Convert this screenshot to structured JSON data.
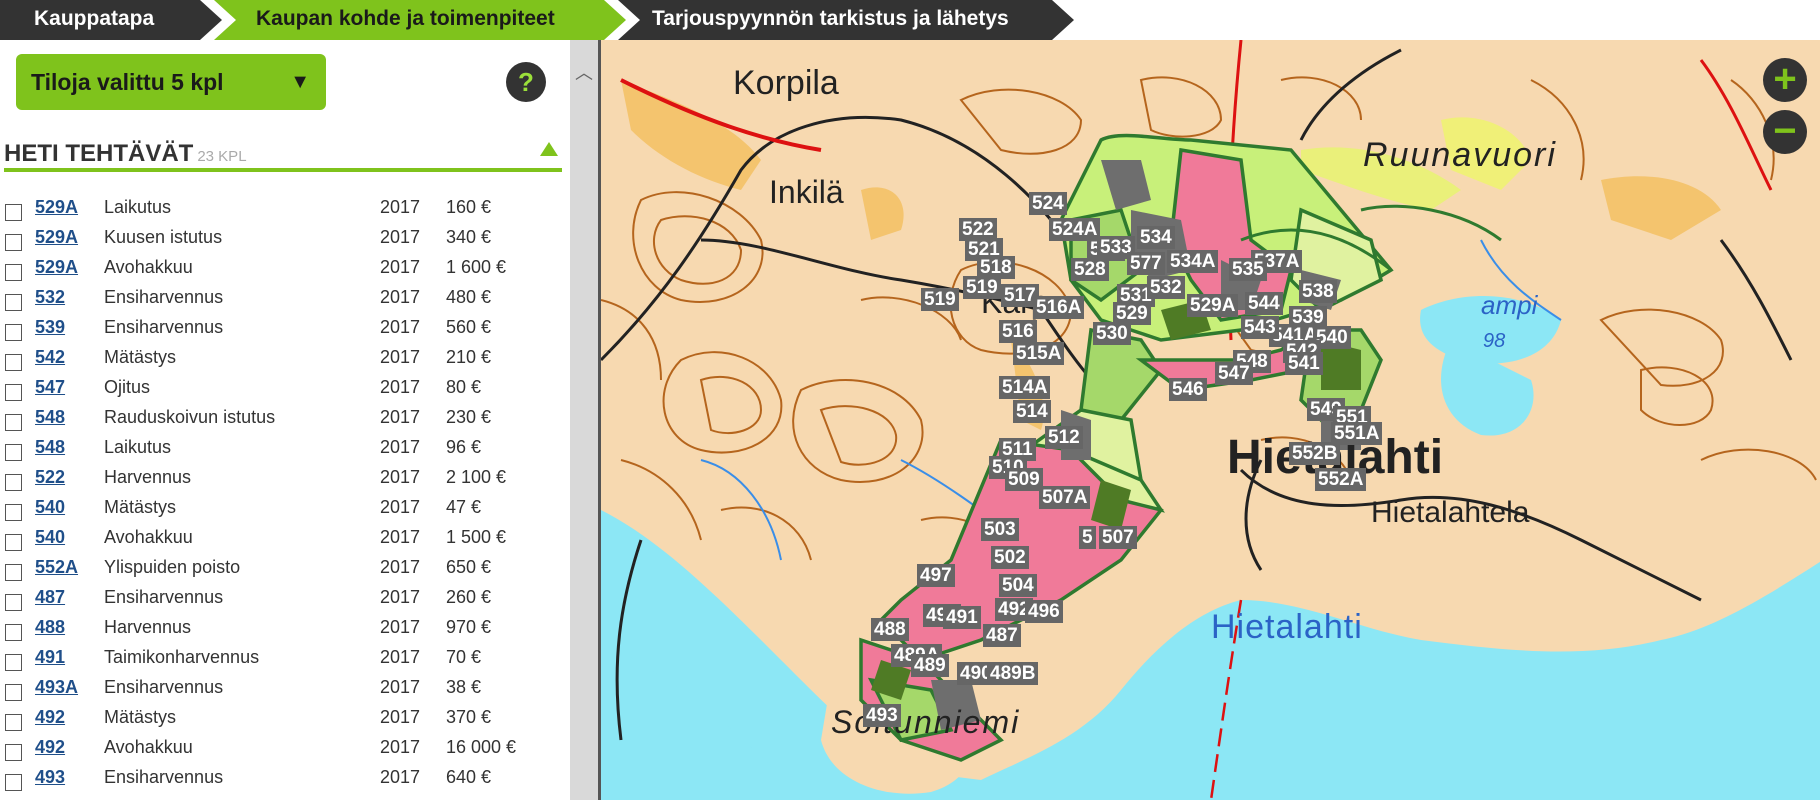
{
  "wizard": {
    "step1": "Kauppatapa",
    "step2": "Kaupan kohde ja toimenpiteet",
    "step3": "Tarjouspyynnön tarkistus ja lähetys"
  },
  "selector": {
    "label": "Tiloja valittu 5 kpl",
    "caret": "▼"
  },
  "help": "?",
  "section": {
    "title": "HETI TEHTÄVÄT",
    "count": "23 KPL"
  },
  "tasks": [
    {
      "code": "529A",
      "name": "Laikutus",
      "year": "2017",
      "price": "160 €"
    },
    {
      "code": "529A",
      "name": "Kuusen istutus",
      "year": "2017",
      "price": "340 €"
    },
    {
      "code": "529A",
      "name": "Avohakkuu",
      "year": "2017",
      "price": "1 600 €"
    },
    {
      "code": "532",
      "name": "Ensiharvennus",
      "year": "2017",
      "price": "480 €"
    },
    {
      "code": "539",
      "name": "Ensiharvennus",
      "year": "2017",
      "price": "560 €"
    },
    {
      "code": "542",
      "name": "Mätästys",
      "year": "2017",
      "price": "210 €"
    },
    {
      "code": "547",
      "name": "Ojitus",
      "year": "2017",
      "price": "80 €"
    },
    {
      "code": "548",
      "name": "Rauduskoivun istutus",
      "year": "2017",
      "price": "230 €"
    },
    {
      "code": "548",
      "name": "Laikutus",
      "year": "2017",
      "price": "96 €"
    },
    {
      "code": "522",
      "name": "Harvennus",
      "year": "2017",
      "price": "2 100 €"
    },
    {
      "code": "540",
      "name": "Mätästys",
      "year": "2017",
      "price": "47 €"
    },
    {
      "code": "540",
      "name": "Avohakkuu",
      "year": "2017",
      "price": "1 500 €"
    },
    {
      "code": "552A",
      "name": "Ylispuiden poisto",
      "year": "2017",
      "price": "650 €"
    },
    {
      "code": "487",
      "name": "Ensiharvennus",
      "year": "2017",
      "price": "260 €"
    },
    {
      "code": "488",
      "name": "Harvennus",
      "year": "2017",
      "price": "970 €"
    },
    {
      "code": "491",
      "name": "Taimikonharvennus",
      "year": "2017",
      "price": "70 €"
    },
    {
      "code": "493A",
      "name": "Ensiharvennus",
      "year": "2017",
      "price": "38 €"
    },
    {
      "code": "492",
      "name": "Mätästys",
      "year": "2017",
      "price": "370 €"
    },
    {
      "code": "492",
      "name": "Avohakkuu",
      "year": "2017",
      "price": "16 000 €"
    },
    {
      "code": "493",
      "name": "Ensiharvennus",
      "year": "2017",
      "price": "640 €"
    }
  ],
  "map": {
    "zoom_in": "+",
    "zoom_out": "−",
    "places": {
      "korpila": "Korpila",
      "inkila": "Inkilä",
      "ruunavuori": "Ruunavuori",
      "karp": "Karp",
      "hietalahti": "Hietalahti",
      "hietalahtela": "Hietalahtela",
      "hietalahti_bay": "Hietalahti",
      "soitunniemi": "Soitunniemi",
      "lampi": "ampi",
      "elev": "98"
    },
    "parcels": [
      "524",
      "524A",
      "534",
      "522",
      "521",
      "525",
      "533",
      "534A",
      "537A",
      "535",
      "518",
      "528",
      "577",
      "519",
      "519",
      "531",
      "532",
      "529A",
      "544",
      "538",
      "517",
      "529",
      "516A",
      "539",
      "516",
      "530",
      "541A",
      "540",
      "543",
      "515A",
      "542",
      "548",
      "541",
      "514A",
      "547",
      "514",
      "546",
      "549",
      "551",
      "551A",
      "511",
      "512",
      "552B",
      "510",
      "509",
      "552A",
      "507A",
      "503",
      "5",
      "507",
      "502",
      "497",
      "504",
      "493",
      "492",
      "496",
      "494",
      "491",
      "487",
      "488",
      "489A",
      "489",
      "490",
      "489B"
    ]
  }
}
